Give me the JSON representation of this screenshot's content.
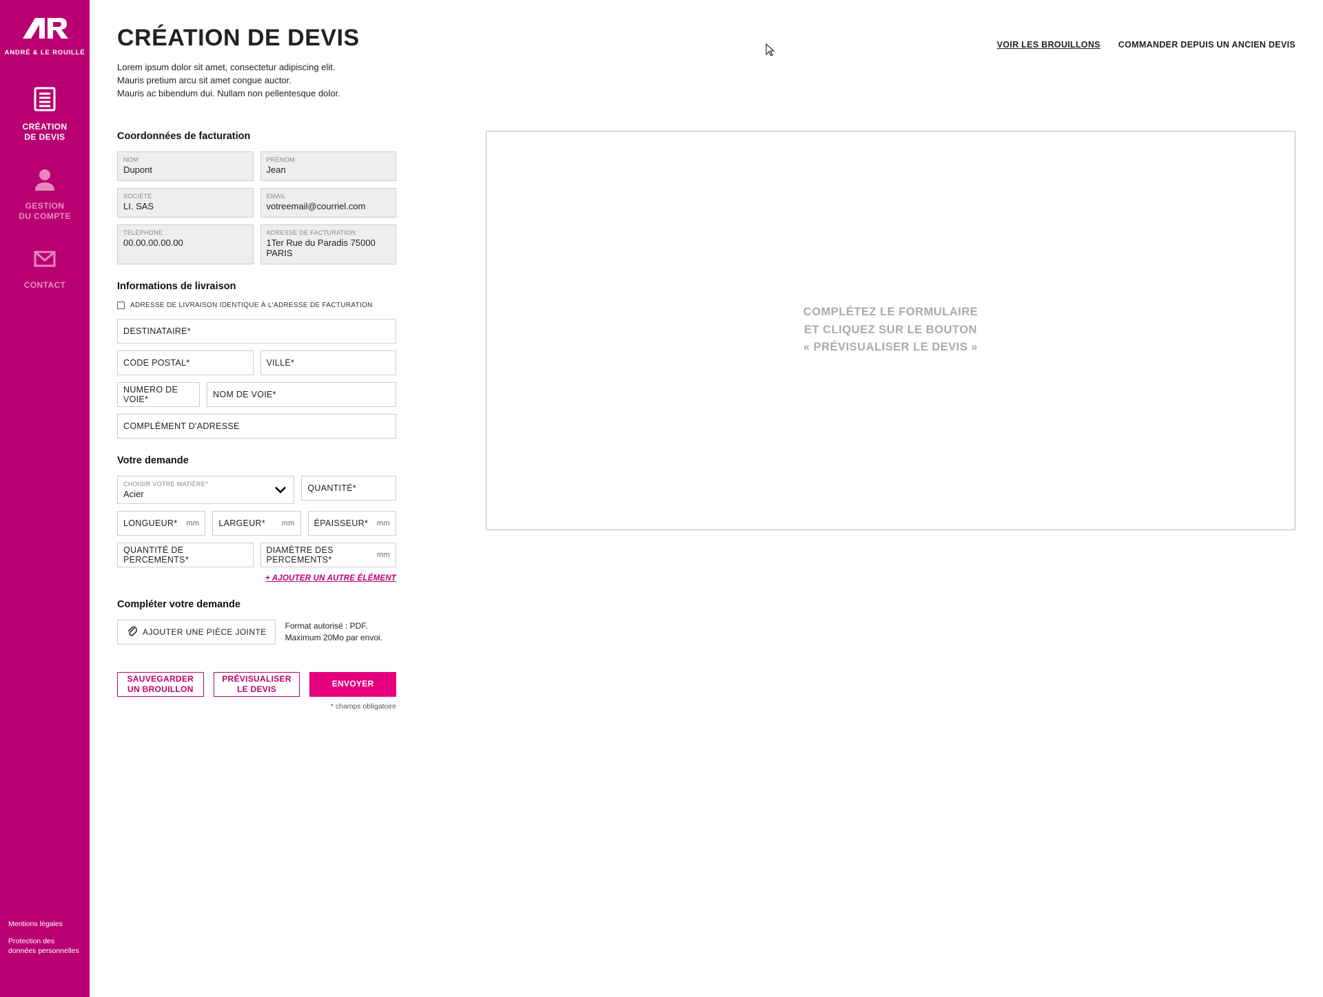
{
  "brand": {
    "name": "ANDRÉ & LE ROUILLÉ"
  },
  "nav": {
    "items": [
      {
        "label": "CRÉATION\nDE DEVIS"
      },
      {
        "label": "GESTION\nDU COMPTE"
      },
      {
        "label": "CONTACT"
      }
    ],
    "footer": {
      "legal": "Mentions légales",
      "privacy": "Protection des données personnelles"
    }
  },
  "header": {
    "title": "CRÉATION DE DEVIS",
    "subtitle": "Lorem ipsum dolor sit amet, consectetur adipiscing elit.\nMauris pretium arcu sit amet congue auctor.\nMauris ac bibendum dui. Nullam non pellentesque dolor.",
    "links": {
      "drafts": "VOIR LES BROUILLONS",
      "reorder": "COMMANDER DEPUIS UN ANCIEN DEVIS"
    }
  },
  "billing": {
    "title": "Coordonnées de facturation",
    "nom": {
      "label": "NOM",
      "value": "Dupont"
    },
    "prenom": {
      "label": "PRÉNOM",
      "value": "Jean"
    },
    "societe": {
      "label": "SOCIÉTÉ",
      "value": "LI. SAS"
    },
    "email": {
      "label": "EMAIL",
      "value": "votreemail@courriel.com"
    },
    "telephone": {
      "label": "TÉLÉPHONE",
      "value": "00.00.00.00.00"
    },
    "adresse": {
      "label": "ADRESSE DE FACTURATION",
      "value": "1Ter Rue du Paradis 75000 PARIS"
    }
  },
  "shipping": {
    "title": "Informations de livraison",
    "same_as_billing": "ADRESSE DE LIVRAISON IDENTIQUE À L'ADRESSE DE FACTURATION",
    "destinataire": "DESTINATAIRE*",
    "code_postal": "CODE POSTAL*",
    "ville": "VILLE*",
    "numero_voie": "NUMERO DE VOIE*",
    "nom_voie": "NOM DE VOIE*",
    "complement": "COMPLÉMENT D'ADRESSE"
  },
  "request": {
    "title": "Votre demande",
    "matiere": {
      "label": "CHOISIR VOTRE MATIÈRE*",
      "value": "Acier"
    },
    "quantite": "QUANTITÉ*",
    "longueur": "LONGUEUR*",
    "largeur": "LARGEUR*",
    "epaisseur": "ÉPAISSEUR*",
    "unit_mm": "mm",
    "qte_percements": "QUANTITÉ DE PERCEMENTS*",
    "diam_percements": "DIAMÈTRE DES PERCEMENTS*",
    "add_link": "+  AJOUTER UN AUTRE ÉLÉMENT"
  },
  "complete": {
    "title": "Compléter votre demande",
    "attach_label": "AJOUTER UNE PIÈCE JOINTE",
    "format_note": "Format autorisé : PDF.\nMaximum 20Mo par envoi."
  },
  "buttons": {
    "save_draft": "SAUVEGARDER\nUN BROUILLON",
    "preview": "PRÉVISUALISER\nLE DEVIS",
    "send": "ENVOYER",
    "required_note": "* champs obligatoire"
  },
  "preview": {
    "text": "COMPLÉTEZ LE FORMULAIRE\nET CLIQUEZ SUR LE BOUTON\n« PRÉVISUALISER LE DEVIS »"
  }
}
